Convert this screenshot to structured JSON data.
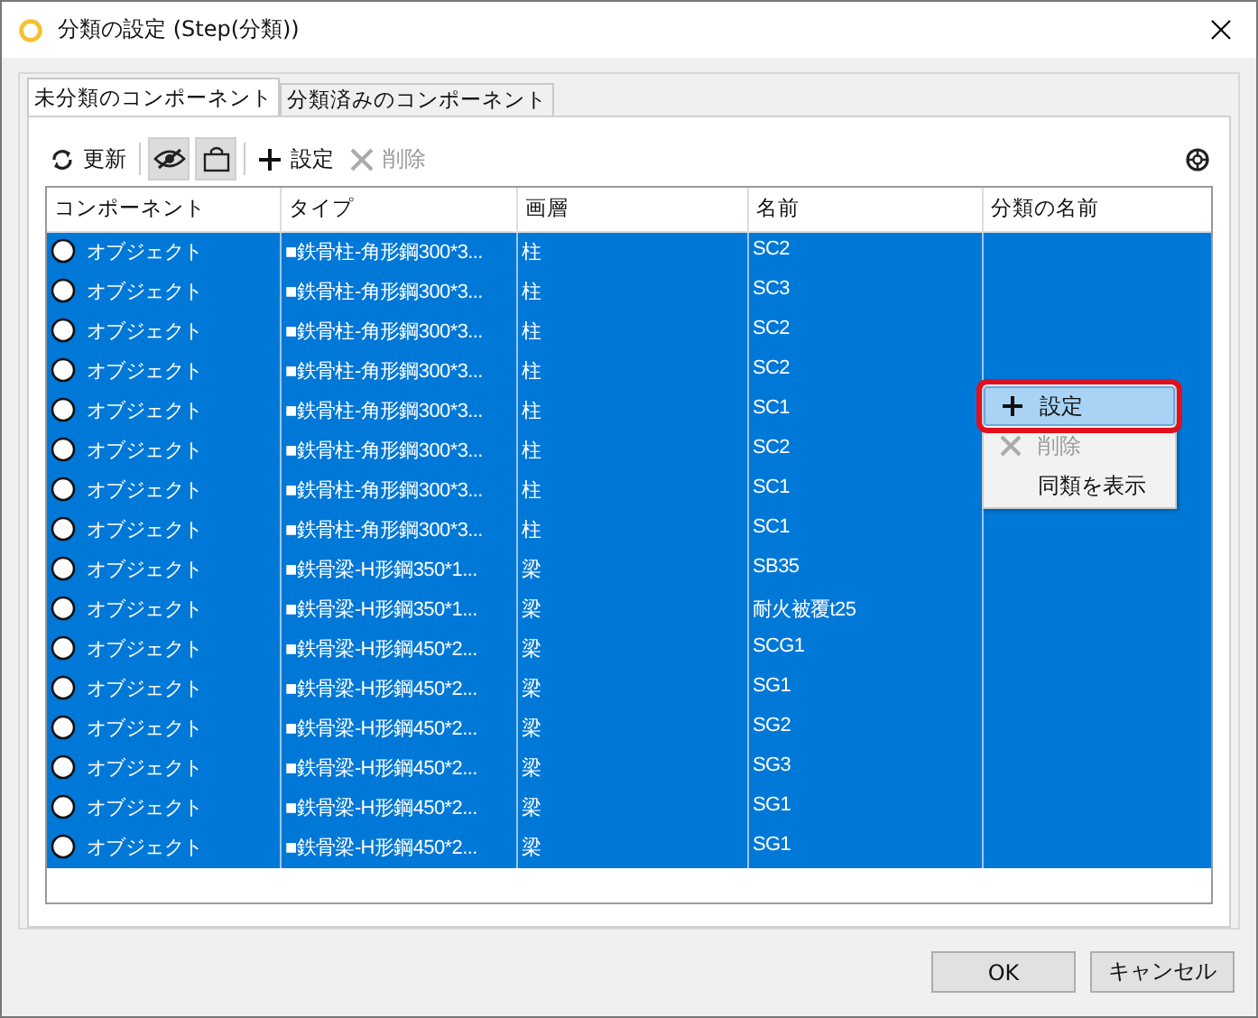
{
  "window": {
    "title": "分類の設定 (Step(分類))"
  },
  "tabs": [
    {
      "label": "未分類のコンポーネント",
      "selected": true
    },
    {
      "label": "分類済みのコンポーネント",
      "selected": false
    }
  ],
  "toolbar": {
    "refresh": "更新",
    "toggles": [
      {
        "kind": "hide",
        "on": true
      },
      {
        "kind": "box",
        "on": true
      }
    ],
    "actions": [
      {
        "kind": "add",
        "label": "設定",
        "disabled": false
      },
      {
        "kind": "delete",
        "label": "削除",
        "disabled": true
      }
    ]
  },
  "table": {
    "columns": [
      "コンポーネント",
      "タイプ",
      "画層",
      "名前",
      "分類の名前"
    ],
    "rows": [
      {
        "component": "オブジェクト",
        "type": "■鉄骨柱-角形鋼300*3...",
        "layer": "柱",
        "name": "SC2",
        "selected": true
      },
      {
        "component": "オブジェクト",
        "type": "■鉄骨柱-角形鋼300*3...",
        "layer": "柱",
        "name": "SC3",
        "selected": true
      },
      {
        "component": "オブジェクト",
        "type": "■鉄骨柱-角形鋼300*3...",
        "layer": "柱",
        "name": "SC2",
        "selected": true
      },
      {
        "component": "オブジェクト",
        "type": "■鉄骨柱-角形鋼300*3...",
        "layer": "柱",
        "name": "SC2",
        "selected": true
      },
      {
        "component": "オブジェクト",
        "type": "■鉄骨柱-角形鋼300*3...",
        "layer": "柱",
        "name": "SC1",
        "selected": true
      },
      {
        "component": "オブジェクト",
        "type": "■鉄骨柱-角形鋼300*3...",
        "layer": "柱",
        "name": "SC2",
        "selected": true
      },
      {
        "component": "オブジェクト",
        "type": "■鉄骨柱-角形鋼300*3...",
        "layer": "柱",
        "name": "SC1",
        "selected": true
      },
      {
        "component": "オブジェクト",
        "type": "■鉄骨柱-角形鋼300*3...",
        "layer": "柱",
        "name": "SC1",
        "selected": true
      },
      {
        "component": "オブジェクト",
        "type": "■鉄骨梁-H形鋼350*1...",
        "layer": "梁",
        "name": "SB35",
        "selected": true
      },
      {
        "component": "オブジェクト",
        "type": "■鉄骨梁-H形鋼350*1...",
        "layer": "梁",
        "name": "耐火被覆t25",
        "selected": true
      },
      {
        "component": "オブジェクト",
        "type": "■鉄骨梁-H形鋼450*2...",
        "layer": "梁",
        "name": "SCG1",
        "selected": true
      },
      {
        "component": "オブジェクト",
        "type": "■鉄骨梁-H形鋼450*2...",
        "layer": "梁",
        "name": "SG1",
        "selected": true
      },
      {
        "component": "オブジェクト",
        "type": "■鉄骨梁-H形鋼450*2...",
        "layer": "梁",
        "name": "SG2",
        "selected": true
      },
      {
        "component": "オブジェクト",
        "type": "■鉄骨梁-H形鋼450*2...",
        "layer": "梁",
        "name": "SG3",
        "selected": true
      },
      {
        "component": "オブジェクト",
        "type": "■鉄骨梁-H形鋼450*2...",
        "layer": "梁",
        "name": "SG1",
        "selected": true
      },
      {
        "component": "オブジェクト",
        "type": "■鉄骨梁-H形鋼450*2...",
        "layer": "梁",
        "name": "SG1",
        "selected": true
      }
    ]
  },
  "context_menu": [
    {
      "kind": "add",
      "label": "設定",
      "disabled": false,
      "selected": true
    },
    {
      "kind": "delete",
      "label": "削除",
      "disabled": true,
      "selected": false
    },
    {
      "kind": "plain",
      "label": "同類を表示",
      "disabled": false,
      "selected": false
    }
  ],
  "buttons": [
    "OK",
    "キャンセル"
  ]
}
